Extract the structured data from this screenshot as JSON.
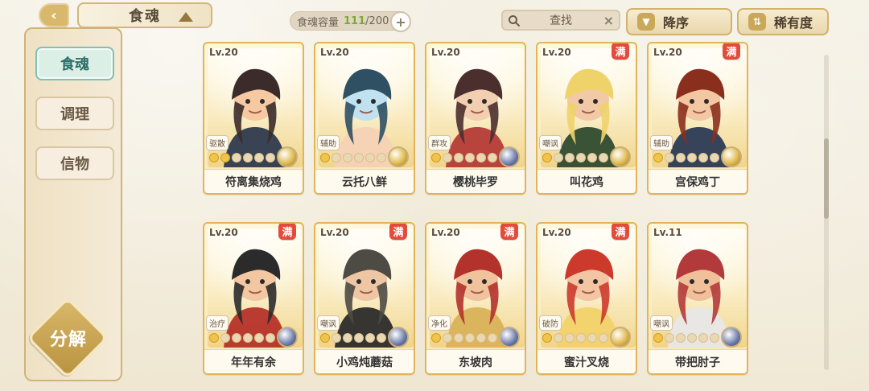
{
  "top": {
    "back_icon": "back-icon",
    "title": "食魂",
    "title_ornament_icon": "crown-icon",
    "capacity_label": "食魂容量",
    "capacity_current": "111",
    "capacity_total": "200",
    "capacity_plus": "+",
    "search_placeholder": "查找",
    "search_clear": "×",
    "sort_desc_label": "降序",
    "sort_rarity_label": "稀有度"
  },
  "sidebar": {
    "tabs": [
      {
        "label": "食魂",
        "active": true
      },
      {
        "label": "调理",
        "active": false
      },
      {
        "label": "信物",
        "active": false
      }
    ],
    "decompose_label": "分解"
  },
  "cards": [
    {
      "level": "Lv.20",
      "name": "符离集烧鸡",
      "role": "驱散",
      "full": false,
      "stars": 2,
      "orb": "gold"
    },
    {
      "level": "Lv.20",
      "name": "云托八鲜",
      "role": "辅助",
      "full": false,
      "stars": 1,
      "orb": "gold"
    },
    {
      "level": "Lv.20",
      "name": "樱桃毕罗",
      "role": "群攻",
      "full": false,
      "stars": 1,
      "orb": "blue"
    },
    {
      "level": "Lv.20",
      "name": "叫花鸡",
      "role": "嘲讽",
      "full": true,
      "stars": 1,
      "orb": "gold"
    },
    {
      "level": "Lv.20",
      "name": "宫保鸡丁",
      "role": "辅助",
      "full": true,
      "stars": 1,
      "orb": "gold"
    },
    {
      "level": "Lv.20",
      "name": "年年有余",
      "role": "治疗",
      "full": true,
      "stars": 1,
      "orb": "blue"
    },
    {
      "level": "Lv.20",
      "name": "小鸡炖蘑菇",
      "role": "嘲讽",
      "full": true,
      "stars": 1,
      "orb": "blue"
    },
    {
      "level": "Lv.20",
      "name": "东坡肉",
      "role": "净化",
      "full": true,
      "stars": 1,
      "orb": "blue"
    },
    {
      "level": "Lv.20",
      "name": "蜜汁叉烧",
      "role": "破防",
      "full": true,
      "stars": 1,
      "orb": "gold"
    },
    {
      "level": "Lv.11",
      "name": "带把肘子",
      "role": "嘲讽",
      "full": false,
      "stars": 1,
      "orb": "blue"
    }
  ],
  "colors": {
    "accent_gold": "#e2b45a",
    "badge_red": "#e44b3b",
    "active_tab": "#7fc1b5"
  }
}
